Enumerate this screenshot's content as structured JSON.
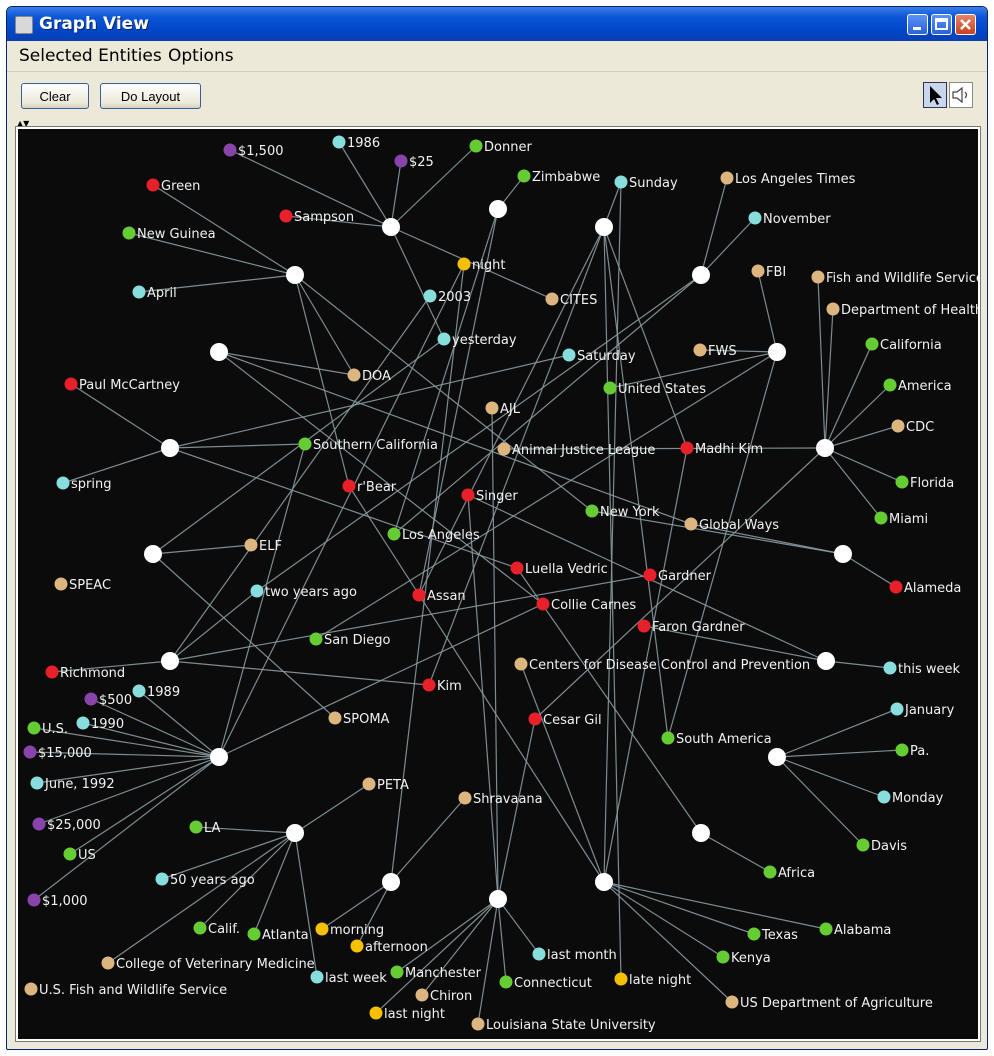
{
  "window": {
    "title": "Graph View"
  },
  "menu": {
    "items": [
      "Selected Entities",
      "Options"
    ]
  },
  "toolbar": {
    "clear_label": "Clear",
    "layout_label": "Do Layout"
  },
  "tools": [
    {
      "icon": "arrow-cursor-icon",
      "active": true
    },
    {
      "icon": "speaker-icon",
      "active": false
    }
  ],
  "colors": {
    "person": "#e8202a",
    "place": "#66cc33",
    "time": "#88dddd",
    "organization": "#ddb57e",
    "money": "#8844aa",
    "time_of_day": "#f5c000",
    "hub": "#ffffff",
    "edge": "#8a9aa0",
    "background": "#0b0b0b"
  },
  "graph": {
    "hubs": [
      {
        "id": "h1"
      },
      {
        "id": "h2"
      },
      {
        "id": "h3"
      },
      {
        "id": "h4"
      },
      {
        "id": "h5"
      },
      {
        "id": "h6"
      },
      {
        "id": "h7"
      },
      {
        "id": "h8"
      },
      {
        "id": "h9"
      },
      {
        "id": "h10"
      },
      {
        "id": "h11"
      },
      {
        "id": "h12"
      },
      {
        "id": "h13"
      },
      {
        "id": "h14"
      },
      {
        "id": "h15"
      },
      {
        "id": "h16"
      },
      {
        "id": "h17"
      },
      {
        "id": "h18"
      },
      {
        "id": "h19"
      },
      {
        "id": "h20"
      }
    ],
    "entities": [
      {
        "id": "e1",
        "label": "$1,500",
        "type": "money"
      },
      {
        "id": "e2",
        "label": "1986",
        "type": "time"
      },
      {
        "id": "e3",
        "label": "$25",
        "type": "money"
      },
      {
        "id": "e4",
        "label": "Donner",
        "type": "place"
      },
      {
        "id": "e5",
        "label": "Green",
        "type": "person"
      },
      {
        "id": "e6",
        "label": "Zimbabwe",
        "type": "place"
      },
      {
        "id": "e7",
        "label": "Sunday",
        "type": "time"
      },
      {
        "id": "e8",
        "label": "Los Angeles Times",
        "type": "organization"
      },
      {
        "id": "e9",
        "label": "Sampson",
        "type": "person"
      },
      {
        "id": "e10",
        "label": "November",
        "type": "time"
      },
      {
        "id": "e11",
        "label": "New Guinea",
        "type": "place"
      },
      {
        "id": "e12",
        "label": "night",
        "type": "time_of_day"
      },
      {
        "id": "e13",
        "label": "FBI",
        "type": "organization"
      },
      {
        "id": "e14",
        "label": "Fish and Wildlife Service",
        "type": "organization"
      },
      {
        "id": "e15",
        "label": "April",
        "type": "time"
      },
      {
        "id": "e16",
        "label": "2003",
        "type": "time"
      },
      {
        "id": "e17",
        "label": "CITES",
        "type": "organization"
      },
      {
        "id": "e18",
        "label": "Department of Health",
        "type": "organization"
      },
      {
        "id": "e19",
        "label": "yesterday",
        "type": "time"
      },
      {
        "id": "e20",
        "label": "California",
        "type": "place"
      },
      {
        "id": "e21",
        "label": "FWS",
        "type": "organization"
      },
      {
        "id": "e22",
        "label": "Saturday",
        "type": "time"
      },
      {
        "id": "e23",
        "label": "DOA",
        "type": "organization"
      },
      {
        "id": "e24",
        "label": "Paul McCartney",
        "type": "person"
      },
      {
        "id": "e25",
        "label": "United States",
        "type": "place"
      },
      {
        "id": "e26",
        "label": "America",
        "type": "place"
      },
      {
        "id": "e27",
        "label": "AJL",
        "type": "organization"
      },
      {
        "id": "e28",
        "label": "CDC",
        "type": "organization"
      },
      {
        "id": "e29",
        "label": "Southern California",
        "type": "place"
      },
      {
        "id": "e30",
        "label": "Animal Justice League",
        "type": "organization"
      },
      {
        "id": "e31",
        "label": "Madhi Kim",
        "type": "person"
      },
      {
        "id": "e32",
        "label": "spring",
        "type": "time"
      },
      {
        "id": "e33",
        "label": "r'Bear",
        "type": "person"
      },
      {
        "id": "e34",
        "label": "Florida",
        "type": "place"
      },
      {
        "id": "e35",
        "label": "Singer",
        "type": "person"
      },
      {
        "id": "e36",
        "label": "New York",
        "type": "place"
      },
      {
        "id": "e37",
        "label": "Miami",
        "type": "place"
      },
      {
        "id": "e38",
        "label": "Global Ways",
        "type": "organization"
      },
      {
        "id": "e39",
        "label": "ELF",
        "type": "organization"
      },
      {
        "id": "e40",
        "label": "Los Angeles",
        "type": "place"
      },
      {
        "id": "e41",
        "label": "Luella Vedric",
        "type": "person"
      },
      {
        "id": "e42",
        "label": "Gardner",
        "type": "person"
      },
      {
        "id": "e43",
        "label": "SPEAC",
        "type": "organization"
      },
      {
        "id": "e44",
        "label": "two years ago",
        "type": "time"
      },
      {
        "id": "e45",
        "label": "Assan",
        "type": "person"
      },
      {
        "id": "e46",
        "label": "Collie Carnes",
        "type": "person"
      },
      {
        "id": "e47",
        "label": "Alameda",
        "type": "person"
      },
      {
        "id": "e48",
        "label": "San Diego",
        "type": "place"
      },
      {
        "id": "e49",
        "label": "Faron Gardner",
        "type": "person"
      },
      {
        "id": "e50",
        "label": "Richmond",
        "type": "person"
      },
      {
        "id": "e51",
        "label": "Centers for Disease Control and Prevention",
        "type": "organization"
      },
      {
        "id": "e52",
        "label": "this week",
        "type": "time"
      },
      {
        "id": "e53",
        "label": "1989",
        "type": "time"
      },
      {
        "id": "e54",
        "label": "$500",
        "type": "money"
      },
      {
        "id": "e55",
        "label": "Kim",
        "type": "person"
      },
      {
        "id": "e56",
        "label": "U.S.",
        "type": "place"
      },
      {
        "id": "e57",
        "label": "1990",
        "type": "time"
      },
      {
        "id": "e58",
        "label": "SPOMA",
        "type": "organization"
      },
      {
        "id": "e59",
        "label": "Cesar Gil",
        "type": "person"
      },
      {
        "id": "e60",
        "label": "January",
        "type": "time"
      },
      {
        "id": "e61",
        "label": "$15,000",
        "type": "money"
      },
      {
        "id": "e62",
        "label": "South America",
        "type": "place"
      },
      {
        "id": "e63",
        "label": "Pa.",
        "type": "place"
      },
      {
        "id": "e64",
        "label": "June, 1992",
        "type": "time"
      },
      {
        "id": "e65",
        "label": "PETA",
        "type": "organization"
      },
      {
        "id": "e66",
        "label": "Shravaana",
        "type": "organization"
      },
      {
        "id": "e67",
        "label": "Monday",
        "type": "time"
      },
      {
        "id": "e68",
        "label": "$25,000",
        "type": "money"
      },
      {
        "id": "e69",
        "label": "LA",
        "type": "place"
      },
      {
        "id": "e70",
        "label": "US",
        "type": "place"
      },
      {
        "id": "e71",
        "label": "Davis",
        "type": "place"
      },
      {
        "id": "e72",
        "label": "Africa",
        "type": "place"
      },
      {
        "id": "e73",
        "label": "50 years ago",
        "type": "time"
      },
      {
        "id": "e74",
        "label": "$1,000",
        "type": "money"
      },
      {
        "id": "e75",
        "label": "Calif.",
        "type": "place"
      },
      {
        "id": "e76",
        "label": "Atlanta",
        "type": "place"
      },
      {
        "id": "e77",
        "label": "morning",
        "type": "time_of_day"
      },
      {
        "id": "e78",
        "label": "Alabama",
        "type": "place"
      },
      {
        "id": "e79",
        "label": "Texas",
        "type": "place"
      },
      {
        "id": "e80",
        "label": "afternoon",
        "type": "time_of_day"
      },
      {
        "id": "e81",
        "label": "last month",
        "type": "time"
      },
      {
        "id": "e82",
        "label": "Kenya",
        "type": "place"
      },
      {
        "id": "e83",
        "label": "College of Veterinary Medicine",
        "type": "organization"
      },
      {
        "id": "e84",
        "label": "Manchester",
        "type": "place"
      },
      {
        "id": "e85",
        "label": "last week",
        "type": "time"
      },
      {
        "id": "e86",
        "label": "late night",
        "type": "time_of_day"
      },
      {
        "id": "e87",
        "label": "Connecticut",
        "type": "place"
      },
      {
        "id": "e88",
        "label": "U.S. Fish and Wildlife Service",
        "type": "organization"
      },
      {
        "id": "e89",
        "label": "Chiron",
        "type": "organization"
      },
      {
        "id": "e90",
        "label": "US Department of Agriculture",
        "type": "organization"
      },
      {
        "id": "e91",
        "label": "last night",
        "type": "time_of_day"
      },
      {
        "id": "e92",
        "label": "Louisiana State University",
        "type": "organization"
      }
    ],
    "edges": [
      [
        "h1",
        "e1"
      ],
      [
        "h1",
        "e2"
      ],
      [
        "h1",
        "e3"
      ],
      [
        "h1",
        "e4"
      ],
      [
        "h1",
        "e9"
      ],
      [
        "h1",
        "e19"
      ],
      [
        "h1",
        "e17"
      ],
      [
        "h2",
        "e5"
      ],
      [
        "h2",
        "e11"
      ],
      [
        "h2",
        "e15"
      ],
      [
        "h2",
        "e23"
      ],
      [
        "h2",
        "e33"
      ],
      [
        "h2",
        "e36"
      ],
      [
        "h3",
        "e6"
      ],
      [
        "h3",
        "e40"
      ],
      [
        "h3",
        "e45"
      ],
      [
        "h4",
        "e7"
      ],
      [
        "h4",
        "e31"
      ],
      [
        "h4",
        "e62"
      ],
      [
        "h4",
        "e45"
      ],
      [
        "h4",
        "e55"
      ],
      [
        "h4",
        "e86"
      ],
      [
        "h5",
        "e8"
      ],
      [
        "h5",
        "e10"
      ],
      [
        "h5",
        "e40"
      ],
      [
        "h5",
        "e44"
      ],
      [
        "h6",
        "e23"
      ],
      [
        "h6",
        "e46"
      ],
      [
        "h6",
        "e38"
      ],
      [
        "h7",
        "e13"
      ],
      [
        "h7",
        "e21"
      ],
      [
        "h7",
        "e25"
      ],
      [
        "h7",
        "e48"
      ],
      [
        "h7",
        "e62"
      ],
      [
        "h8",
        "e24"
      ],
      [
        "h8",
        "e32"
      ],
      [
        "h8",
        "e29"
      ],
      [
        "h8",
        "e22"
      ],
      [
        "h8",
        "e41"
      ],
      [
        "h9",
        "e14"
      ],
      [
        "h9",
        "e18"
      ],
      [
        "h9",
        "e20"
      ],
      [
        "h9",
        "e26"
      ],
      [
        "h9",
        "e28"
      ],
      [
        "h9",
        "e34"
      ],
      [
        "h9",
        "e37"
      ],
      [
        "h9",
        "e30"
      ],
      [
        "h9",
        "e59"
      ],
      [
        "h10",
        "e39"
      ],
      [
        "h10",
        "e19"
      ],
      [
        "h10",
        "e58"
      ],
      [
        "h11",
        "e47"
      ],
      [
        "h11",
        "e38"
      ],
      [
        "h11",
        "e36"
      ],
      [
        "h12",
        "e50"
      ],
      [
        "h12",
        "e16"
      ],
      [
        "h12",
        "e55"
      ],
      [
        "h12",
        "e42"
      ],
      [
        "h12",
        "e44"
      ],
      [
        "h13",
        "e52"
      ],
      [
        "h13",
        "e49"
      ],
      [
        "h13",
        "e35"
      ],
      [
        "h14",
        "e53"
      ],
      [
        "h14",
        "e54"
      ],
      [
        "h14",
        "e56"
      ],
      [
        "h14",
        "e57"
      ],
      [
        "h14",
        "e61"
      ],
      [
        "h14",
        "e64"
      ],
      [
        "h14",
        "e68"
      ],
      [
        "h14",
        "e70"
      ],
      [
        "h14",
        "e74"
      ],
      [
        "h14",
        "e29"
      ],
      [
        "h14",
        "e46"
      ],
      [
        "h14",
        "e12"
      ],
      [
        "h15",
        "e60"
      ],
      [
        "h15",
        "e63"
      ],
      [
        "h15",
        "e67"
      ],
      [
        "h15",
        "e71"
      ],
      [
        "h16",
        "e69"
      ],
      [
        "h16",
        "e73"
      ],
      [
        "h16",
        "e75"
      ],
      [
        "h16",
        "e76"
      ],
      [
        "h16",
        "e83"
      ],
      [
        "h16",
        "e85"
      ],
      [
        "h16",
        "e65"
      ],
      [
        "h17",
        "e72"
      ],
      [
        "h17",
        "e41"
      ],
      [
        "h18",
        "e77"
      ],
      [
        "h18",
        "e80"
      ],
      [
        "h18",
        "e66"
      ],
      [
        "h18",
        "e12"
      ],
      [
        "h19",
        "e91"
      ],
      [
        "h19",
        "e89"
      ],
      [
        "h19",
        "e92"
      ],
      [
        "h19",
        "e84"
      ],
      [
        "h19",
        "e87"
      ],
      [
        "h19",
        "e81"
      ],
      [
        "h19",
        "e27"
      ],
      [
        "h19",
        "e59"
      ],
      [
        "h19",
        "e35"
      ],
      [
        "h20",
        "e78"
      ],
      [
        "h20",
        "e79"
      ],
      [
        "h20",
        "e82"
      ],
      [
        "h20",
        "e90"
      ],
      [
        "h20",
        "e51"
      ],
      [
        "h20",
        "e31"
      ],
      [
        "h20",
        "e7"
      ],
      [
        "h20",
        "e33"
      ]
    ]
  }
}
